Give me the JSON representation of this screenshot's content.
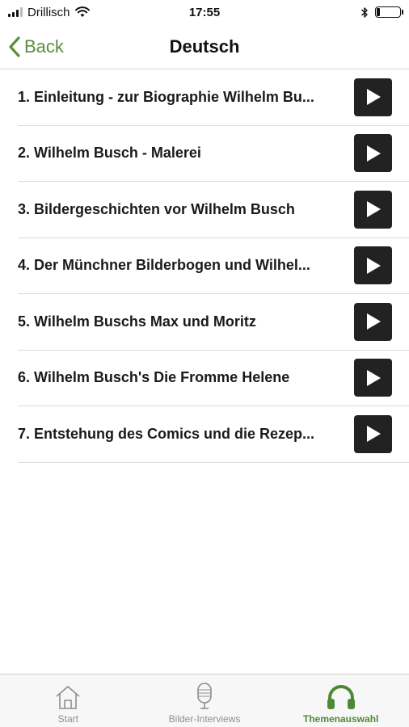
{
  "status_bar": {
    "carrier": "Drillisch",
    "time": "17:55",
    "battery_level": 0.15
  },
  "nav": {
    "back_label": "Back",
    "title": "Deutsch"
  },
  "topics": [
    {
      "label": "1. Einleitung - zur Biographie Wilhelm Bu..."
    },
    {
      "label": "2. Wilhelm Busch - Malerei"
    },
    {
      "label": "3. Bildergeschichten vor Wilhelm Busch"
    },
    {
      "label": "4. Der Münchner Bilderbogen und Wilhel..."
    },
    {
      "label": "5. Wilhelm Buschs Max und Moritz"
    },
    {
      "label": "6. Wilhelm Busch's Die Fromme Helene"
    },
    {
      "label": "7. Entstehung des Comics und die Rezep..."
    }
  ],
  "tabs": [
    {
      "label": "Start",
      "icon": "house-icon",
      "active": false
    },
    {
      "label": "Bilder-Interviews",
      "icon": "microphone-icon",
      "active": false
    },
    {
      "label": "Themenauswahl",
      "icon": "headphones-icon",
      "active": true
    }
  ],
  "colors": {
    "accent": "#5a8f3c",
    "play_button": "#222222"
  }
}
